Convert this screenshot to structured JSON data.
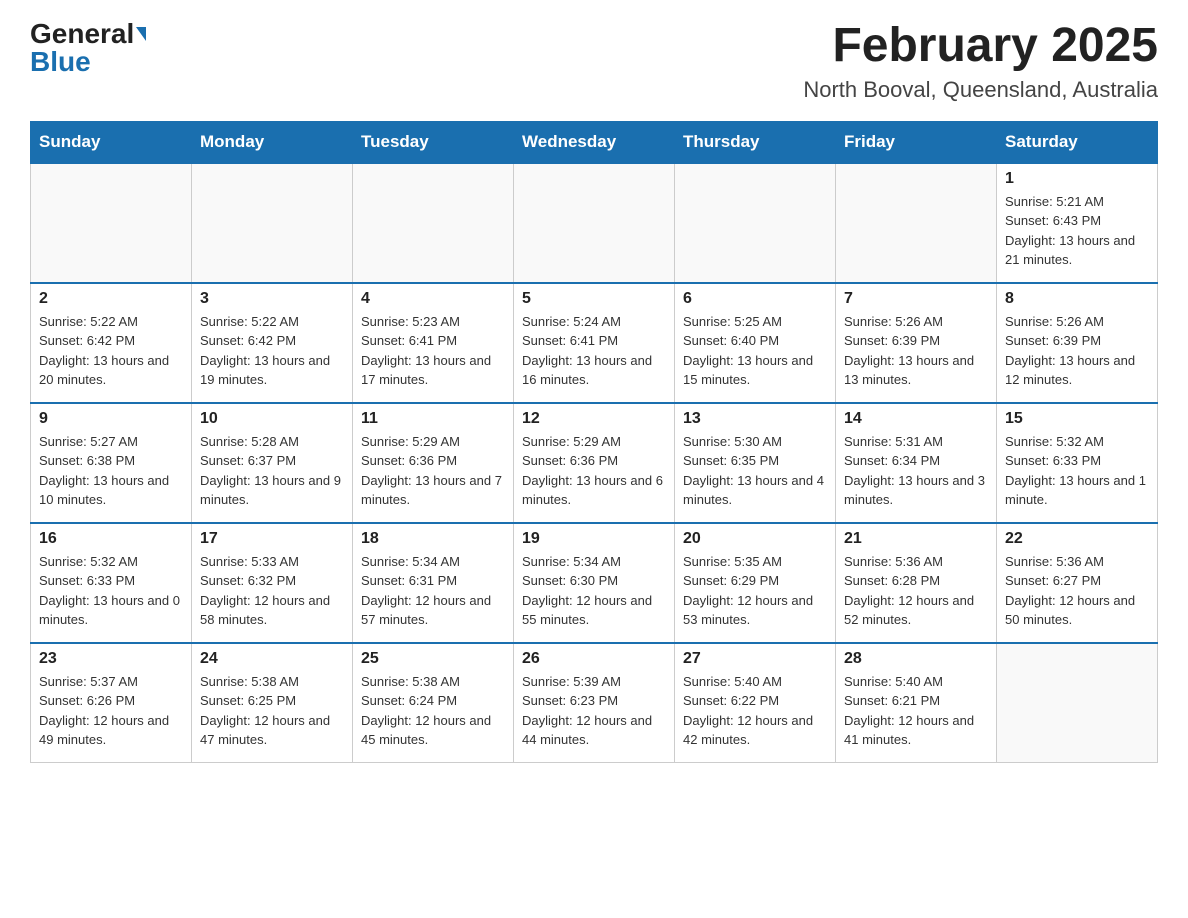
{
  "header": {
    "logo_general": "General",
    "logo_blue": "Blue",
    "title": "February 2025",
    "location": "North Booval, Queensland, Australia"
  },
  "weekdays": [
    "Sunday",
    "Monday",
    "Tuesday",
    "Wednesday",
    "Thursday",
    "Friday",
    "Saturday"
  ],
  "weeks": [
    [
      {
        "day": "",
        "info": ""
      },
      {
        "day": "",
        "info": ""
      },
      {
        "day": "",
        "info": ""
      },
      {
        "day": "",
        "info": ""
      },
      {
        "day": "",
        "info": ""
      },
      {
        "day": "",
        "info": ""
      },
      {
        "day": "1",
        "info": "Sunrise: 5:21 AM\nSunset: 6:43 PM\nDaylight: 13 hours and 21 minutes."
      }
    ],
    [
      {
        "day": "2",
        "info": "Sunrise: 5:22 AM\nSunset: 6:42 PM\nDaylight: 13 hours and 20 minutes."
      },
      {
        "day": "3",
        "info": "Sunrise: 5:22 AM\nSunset: 6:42 PM\nDaylight: 13 hours and 19 minutes."
      },
      {
        "day": "4",
        "info": "Sunrise: 5:23 AM\nSunset: 6:41 PM\nDaylight: 13 hours and 17 minutes."
      },
      {
        "day": "5",
        "info": "Sunrise: 5:24 AM\nSunset: 6:41 PM\nDaylight: 13 hours and 16 minutes."
      },
      {
        "day": "6",
        "info": "Sunrise: 5:25 AM\nSunset: 6:40 PM\nDaylight: 13 hours and 15 minutes."
      },
      {
        "day": "7",
        "info": "Sunrise: 5:26 AM\nSunset: 6:39 PM\nDaylight: 13 hours and 13 minutes."
      },
      {
        "day": "8",
        "info": "Sunrise: 5:26 AM\nSunset: 6:39 PM\nDaylight: 13 hours and 12 minutes."
      }
    ],
    [
      {
        "day": "9",
        "info": "Sunrise: 5:27 AM\nSunset: 6:38 PM\nDaylight: 13 hours and 10 minutes."
      },
      {
        "day": "10",
        "info": "Sunrise: 5:28 AM\nSunset: 6:37 PM\nDaylight: 13 hours and 9 minutes."
      },
      {
        "day": "11",
        "info": "Sunrise: 5:29 AM\nSunset: 6:36 PM\nDaylight: 13 hours and 7 minutes."
      },
      {
        "day": "12",
        "info": "Sunrise: 5:29 AM\nSunset: 6:36 PM\nDaylight: 13 hours and 6 minutes."
      },
      {
        "day": "13",
        "info": "Sunrise: 5:30 AM\nSunset: 6:35 PM\nDaylight: 13 hours and 4 minutes."
      },
      {
        "day": "14",
        "info": "Sunrise: 5:31 AM\nSunset: 6:34 PM\nDaylight: 13 hours and 3 minutes."
      },
      {
        "day": "15",
        "info": "Sunrise: 5:32 AM\nSunset: 6:33 PM\nDaylight: 13 hours and 1 minute."
      }
    ],
    [
      {
        "day": "16",
        "info": "Sunrise: 5:32 AM\nSunset: 6:33 PM\nDaylight: 13 hours and 0 minutes."
      },
      {
        "day": "17",
        "info": "Sunrise: 5:33 AM\nSunset: 6:32 PM\nDaylight: 12 hours and 58 minutes."
      },
      {
        "day": "18",
        "info": "Sunrise: 5:34 AM\nSunset: 6:31 PM\nDaylight: 12 hours and 57 minutes."
      },
      {
        "day": "19",
        "info": "Sunrise: 5:34 AM\nSunset: 6:30 PM\nDaylight: 12 hours and 55 minutes."
      },
      {
        "day": "20",
        "info": "Sunrise: 5:35 AM\nSunset: 6:29 PM\nDaylight: 12 hours and 53 minutes."
      },
      {
        "day": "21",
        "info": "Sunrise: 5:36 AM\nSunset: 6:28 PM\nDaylight: 12 hours and 52 minutes."
      },
      {
        "day": "22",
        "info": "Sunrise: 5:36 AM\nSunset: 6:27 PM\nDaylight: 12 hours and 50 minutes."
      }
    ],
    [
      {
        "day": "23",
        "info": "Sunrise: 5:37 AM\nSunset: 6:26 PM\nDaylight: 12 hours and 49 minutes."
      },
      {
        "day": "24",
        "info": "Sunrise: 5:38 AM\nSunset: 6:25 PM\nDaylight: 12 hours and 47 minutes."
      },
      {
        "day": "25",
        "info": "Sunrise: 5:38 AM\nSunset: 6:24 PM\nDaylight: 12 hours and 45 minutes."
      },
      {
        "day": "26",
        "info": "Sunrise: 5:39 AM\nSunset: 6:23 PM\nDaylight: 12 hours and 44 minutes."
      },
      {
        "day": "27",
        "info": "Sunrise: 5:40 AM\nSunset: 6:22 PM\nDaylight: 12 hours and 42 minutes."
      },
      {
        "day": "28",
        "info": "Sunrise: 5:40 AM\nSunset: 6:21 PM\nDaylight: 12 hours and 41 minutes."
      },
      {
        "day": "",
        "info": ""
      }
    ]
  ],
  "colors": {
    "header_bg": "#1a6faf",
    "header_text": "#ffffff",
    "border_top": "#1a6faf"
  }
}
